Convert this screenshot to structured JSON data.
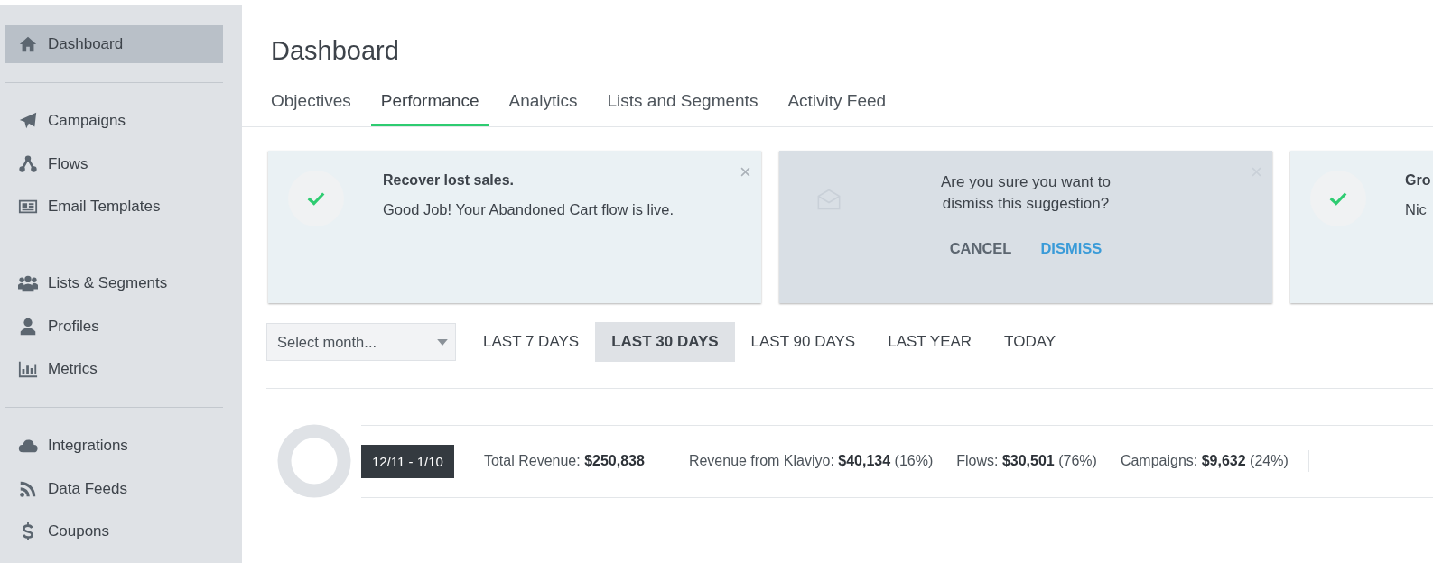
{
  "sidebar": {
    "sections": [
      {
        "items": [
          {
            "label": "Dashboard",
            "selected": true
          }
        ]
      },
      {
        "items": [
          {
            "label": "Campaigns",
            "selected": false
          },
          {
            "label": "Flows",
            "selected": false
          },
          {
            "label": "Email Templates",
            "selected": false
          }
        ]
      },
      {
        "items": [
          {
            "label": "Lists & Segments",
            "selected": false
          },
          {
            "label": "Profiles",
            "selected": false
          },
          {
            "label": "Metrics",
            "selected": false
          }
        ]
      },
      {
        "items": [
          {
            "label": "Integrations",
            "selected": false
          },
          {
            "label": "Data Feeds",
            "selected": false
          },
          {
            "label": "Coupons",
            "selected": false
          }
        ]
      }
    ]
  },
  "page_title": "Dashboard",
  "tabs": [
    {
      "label": "Objectives",
      "selected": false
    },
    {
      "label": "Performance",
      "selected": true
    },
    {
      "label": "Analytics",
      "selected": false
    },
    {
      "label": "Lists and Segments",
      "selected": false
    },
    {
      "label": "Activity Feed",
      "selected": false
    }
  ],
  "suggestions": [
    {
      "kind": "done",
      "title": "Recover lost sales.",
      "text": "Good Job! Your Abandoned Cart flow is live."
    },
    {
      "kind": "confirm",
      "question": "Are you sure you want to dismiss this suggestion?",
      "cancel": "CANCEL",
      "dismiss": "DISMISS"
    },
    {
      "kind": "done",
      "title": "Gro",
      "text": "Nic"
    }
  ],
  "month_select": {
    "placeholder": "Select month..."
  },
  "ranges": [
    {
      "label": "LAST 7 DAYS",
      "selected": false
    },
    {
      "label": "LAST 30 DAYS",
      "selected": true
    },
    {
      "label": "LAST 90 DAYS",
      "selected": false
    },
    {
      "label": "LAST YEAR",
      "selected": false
    },
    {
      "label": "TODAY",
      "selected": false
    }
  ],
  "summary": {
    "date_badge": "12/11 - 1/10",
    "stat_groups": [
      [
        "Total Revenue: **$250,838**"
      ],
      [
        "Revenue from Klaviyo: **$40,134** (16%)",
        "Flows: **$30,501** (76%)",
        "Campaigns: **$9,632** (24%)"
      ]
    ]
  }
}
